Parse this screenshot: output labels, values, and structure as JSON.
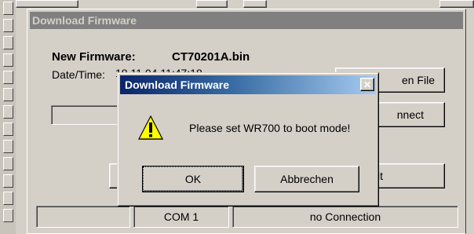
{
  "firmware_window": {
    "title": "Download Firmware",
    "new_firmware_label": "New Firmware:",
    "new_firmware_value": "CT70201A.bin",
    "datetime_label": "Date/Time:",
    "datetime_value": "18.11.04 11:47:18",
    "buttons": {
      "open_file": "en File",
      "connect": "nnect",
      "exit": "Exit",
      "hidden_left": ""
    },
    "progress_percent": 0
  },
  "statusbar": {
    "cell_1": "",
    "port": "COM 1",
    "connection": "no Connection"
  },
  "dialog": {
    "title": "Download Firmware",
    "close_glyph": "✕",
    "icon": "warning-icon",
    "message": "Please set WR700 to boot mode!",
    "ok_label": "OK",
    "cancel_label": "Abbrechen"
  },
  "colors": {
    "title_active_start": "#0a246a",
    "title_active_end": "#a6caf0",
    "title_inactive": "#808080",
    "face": "#d4d0c8",
    "warning_yellow": "#ffff00"
  }
}
